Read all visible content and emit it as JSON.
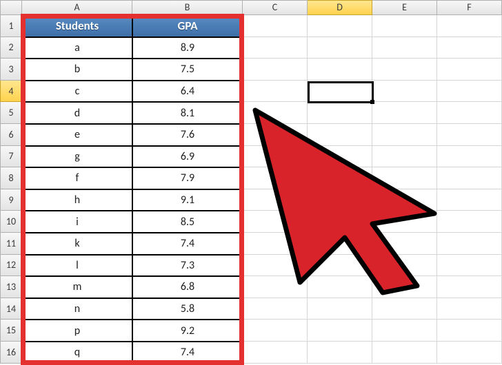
{
  "columns": [
    "A",
    "B",
    "C",
    "D",
    "E",
    "F"
  ],
  "selected_column_index": 3,
  "selected_row_index": 3,
  "headers": {
    "col_a": "Students",
    "col_b": "GPA"
  },
  "rows": [
    {
      "n": "1"
    },
    {
      "n": "2",
      "student": "a",
      "gpa": "8.9"
    },
    {
      "n": "3",
      "student": "b",
      "gpa": "7.5"
    },
    {
      "n": "4",
      "student": "c",
      "gpa": "6.4"
    },
    {
      "n": "5",
      "student": "d",
      "gpa": "8.1"
    },
    {
      "n": "6",
      "student": "e",
      "gpa": "7.6"
    },
    {
      "n": "7",
      "student": "g",
      "gpa": "6.9"
    },
    {
      "n": "8",
      "student": "f",
      "gpa": "7.9"
    },
    {
      "n": "9",
      "student": "h",
      "gpa": "9.1"
    },
    {
      "n": "10",
      "student": "i",
      "gpa": "8.5"
    },
    {
      "n": "11",
      "student": "k",
      "gpa": "7.4"
    },
    {
      "n": "12",
      "student": "l",
      "gpa": "7.3"
    },
    {
      "n": "13",
      "student": "m",
      "gpa": "6.8"
    },
    {
      "n": "14",
      "student": "n",
      "gpa": "5.8"
    },
    {
      "n": "15",
      "student": "p",
      "gpa": "9.2"
    },
    {
      "n": "16",
      "student": "q",
      "gpa": "7.4"
    }
  ],
  "active_cell": {
    "col": "D",
    "row": 4
  }
}
